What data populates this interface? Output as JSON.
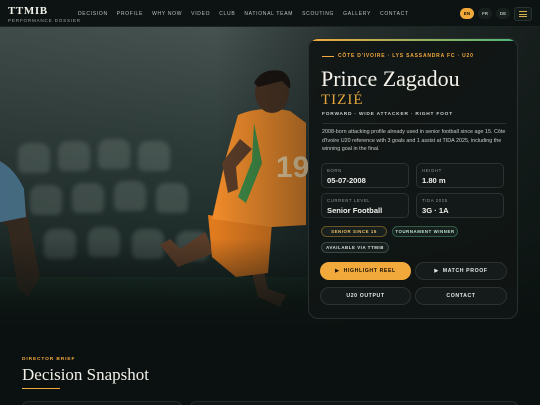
{
  "brand": {
    "name": "TTMIB",
    "tagline": "PERFORMANCE DOSSIER"
  },
  "nav": {
    "links": [
      "DECISION",
      "PROFILE",
      "WHY NOW",
      "VIDEO",
      "CLUB",
      "NATIONAL TEAM",
      "SCOUTING",
      "GALLERY",
      "CONTACT"
    ],
    "languages": [
      "EN",
      "FR",
      "DE"
    ],
    "active_language": "EN"
  },
  "profile": {
    "kicker": "CÔTE D'IVOIRE · LYS SASSANDRA FC · U20",
    "first_name": "Prince Zagadou",
    "surname": "TIZIÉ",
    "role": "FORWARD · WIDE ATTACKER · RIGHT FOOT",
    "bio": "2008-born attacking profile already used in senior football since age 15. Côte d'Ivoire U20 reference with 3 goals and 1 assist at TIDA 2025, including the winning goal in the final.",
    "stats": [
      {
        "label": "BORN",
        "value": "05-07-2008"
      },
      {
        "label": "HEIGHT",
        "value": "1.80 m"
      },
      {
        "label": "CURRENT LEVEL",
        "value": "Senior Football"
      },
      {
        "label": "TIDA 2025",
        "value": "3G · 1A"
      }
    ],
    "tags": [
      "SENIOR SINCE 15",
      "TOURNAMENT WINNER",
      "AVAILABLE VIA TTMIB"
    ],
    "buttons": {
      "highlight": "HIGHLIGHT REEL",
      "match_proof": "MATCH PROOF",
      "u20_output": "U20 OUTPUT",
      "contact": "CONTACT"
    }
  },
  "hero": {
    "jersey_number": "19"
  },
  "section": {
    "kicker": "DIRECTOR BRIEF",
    "title": "Decision Snapshot"
  },
  "colors": {
    "accent": "#f2a93b",
    "accent_green": "#4ab77a",
    "background": "#0b1110"
  },
  "icons": {
    "menu": "hamburger-icon",
    "play": "play-icon"
  }
}
